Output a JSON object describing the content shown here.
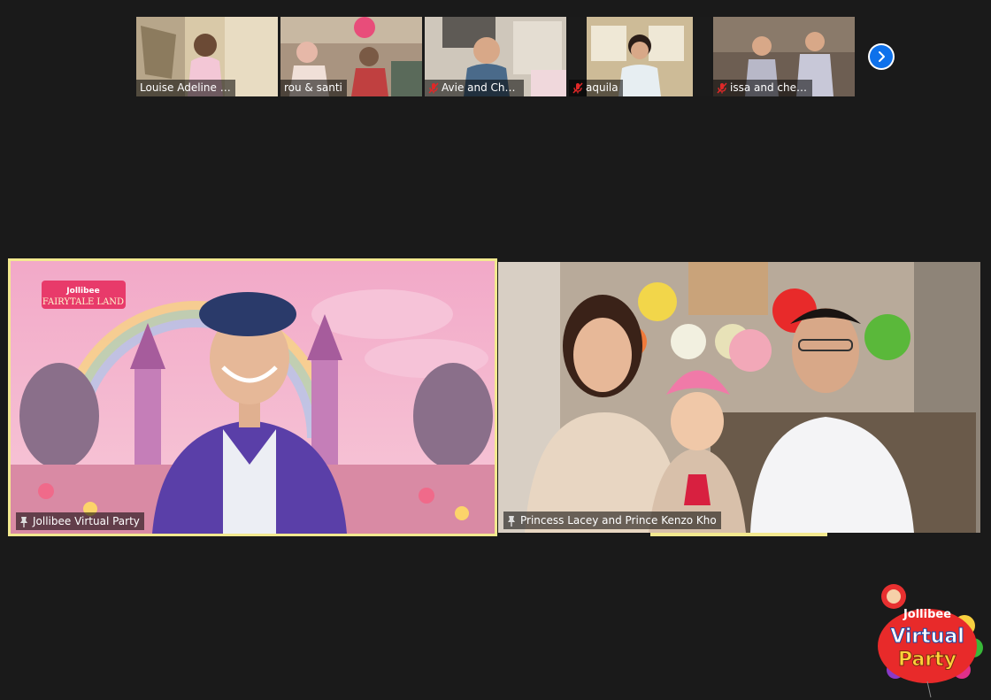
{
  "participants": [
    {
      "name": "Louise Adeline S...",
      "muted": false
    },
    {
      "name": "rou & santi",
      "muted": false
    },
    {
      "name": "Avie and Cha...",
      "muted": true
    },
    {
      "name": "aquila",
      "muted": true
    },
    {
      "name": "issa and ches...",
      "muted": true
    }
  ],
  "main": {
    "left": {
      "name": "Jollibee Virtual Party",
      "pinned": true,
      "active_speaker": true,
      "backdrop_title_top": "Jollibee",
      "backdrop_title_bottom": "FAIRYTALE LAND"
    },
    "right": {
      "name": "Princess Lacey and Prince Kenzo Kho",
      "pinned": true
    }
  },
  "brand": {
    "line1": "Jollibee",
    "line2": "Virtual",
    "line3": "Party"
  },
  "icons": {
    "next": "chevron-right-icon",
    "mute": "mic-muted-icon",
    "pin": "pin-icon"
  },
  "colors": {
    "accent": "#0e71eb",
    "speaker_highlight": "#f3e98f",
    "muted_red": "#e02828",
    "background": "#1a1a1a"
  }
}
